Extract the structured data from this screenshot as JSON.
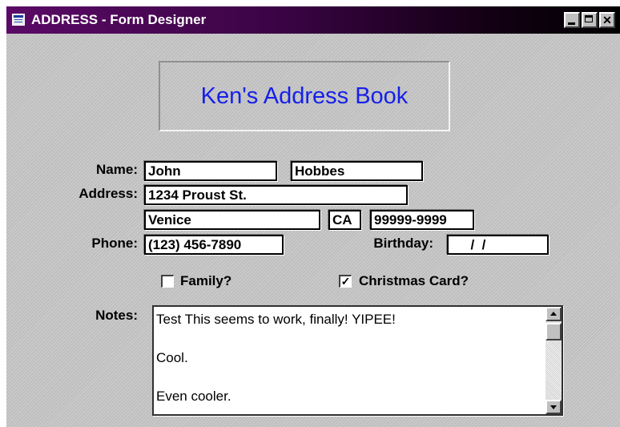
{
  "window": {
    "title": "ADDRESS - Form Designer",
    "controls": {
      "minimize": "_",
      "maximize": "□",
      "close": "✕"
    }
  },
  "form": {
    "heading": "Ken's Address Book",
    "labels": {
      "name": "Name:",
      "address": "Address:",
      "phone": "Phone:",
      "birthday": "Birthday:",
      "notes": "Notes:"
    },
    "fields": {
      "first_name": "John",
      "last_name": "Hobbes",
      "street": "1234 Proust St.",
      "city": "Venice",
      "state": "CA",
      "zip": "99999-9999",
      "phone": "(123) 456-7890",
      "birthday": "  /  /"
    },
    "checkboxes": {
      "family": {
        "label": "Family?",
        "checked": false,
        "mark": ""
      },
      "christmas_card": {
        "label": "Christmas Card?",
        "checked": true,
        "mark": "✓"
      }
    },
    "notes_text": "Test This seems to work, finally! YIPEE!\n\nCool.\n\nEven cooler."
  }
}
